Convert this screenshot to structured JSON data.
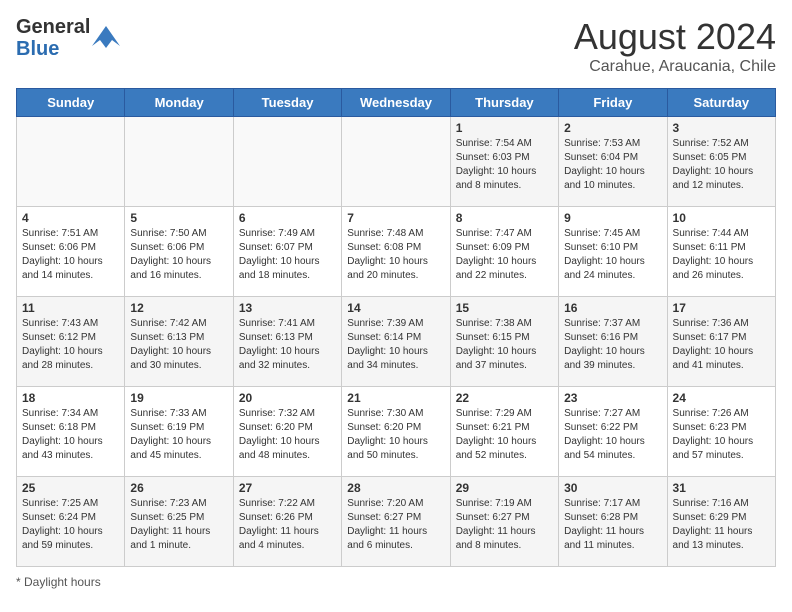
{
  "header": {
    "logo": {
      "text_general": "General",
      "text_blue": "Blue"
    },
    "title": "August 2024",
    "subtitle": "Carahue, Araucania, Chile"
  },
  "calendar": {
    "days_of_week": [
      "Sunday",
      "Monday",
      "Tuesday",
      "Wednesday",
      "Thursday",
      "Friday",
      "Saturday"
    ],
    "weeks": [
      [
        {
          "day": "",
          "info": ""
        },
        {
          "day": "",
          "info": ""
        },
        {
          "day": "",
          "info": ""
        },
        {
          "day": "",
          "info": ""
        },
        {
          "day": "1",
          "info": "Sunrise: 7:54 AM\nSunset: 6:03 PM\nDaylight: 10 hours\nand 8 minutes."
        },
        {
          "day": "2",
          "info": "Sunrise: 7:53 AM\nSunset: 6:04 PM\nDaylight: 10 hours\nand 10 minutes."
        },
        {
          "day": "3",
          "info": "Sunrise: 7:52 AM\nSunset: 6:05 PM\nDaylight: 10 hours\nand 12 minutes."
        }
      ],
      [
        {
          "day": "4",
          "info": "Sunrise: 7:51 AM\nSunset: 6:06 PM\nDaylight: 10 hours\nand 14 minutes."
        },
        {
          "day": "5",
          "info": "Sunrise: 7:50 AM\nSunset: 6:06 PM\nDaylight: 10 hours\nand 16 minutes."
        },
        {
          "day": "6",
          "info": "Sunrise: 7:49 AM\nSunset: 6:07 PM\nDaylight: 10 hours\nand 18 minutes."
        },
        {
          "day": "7",
          "info": "Sunrise: 7:48 AM\nSunset: 6:08 PM\nDaylight: 10 hours\nand 20 minutes."
        },
        {
          "day": "8",
          "info": "Sunrise: 7:47 AM\nSunset: 6:09 PM\nDaylight: 10 hours\nand 22 minutes."
        },
        {
          "day": "9",
          "info": "Sunrise: 7:45 AM\nSunset: 6:10 PM\nDaylight: 10 hours\nand 24 minutes."
        },
        {
          "day": "10",
          "info": "Sunrise: 7:44 AM\nSunset: 6:11 PM\nDaylight: 10 hours\nand 26 minutes."
        }
      ],
      [
        {
          "day": "11",
          "info": "Sunrise: 7:43 AM\nSunset: 6:12 PM\nDaylight: 10 hours\nand 28 minutes."
        },
        {
          "day": "12",
          "info": "Sunrise: 7:42 AM\nSunset: 6:13 PM\nDaylight: 10 hours\nand 30 minutes."
        },
        {
          "day": "13",
          "info": "Sunrise: 7:41 AM\nSunset: 6:13 PM\nDaylight: 10 hours\nand 32 minutes."
        },
        {
          "day": "14",
          "info": "Sunrise: 7:39 AM\nSunset: 6:14 PM\nDaylight: 10 hours\nand 34 minutes."
        },
        {
          "day": "15",
          "info": "Sunrise: 7:38 AM\nSunset: 6:15 PM\nDaylight: 10 hours\nand 37 minutes."
        },
        {
          "day": "16",
          "info": "Sunrise: 7:37 AM\nSunset: 6:16 PM\nDaylight: 10 hours\nand 39 minutes."
        },
        {
          "day": "17",
          "info": "Sunrise: 7:36 AM\nSunset: 6:17 PM\nDaylight: 10 hours\nand 41 minutes."
        }
      ],
      [
        {
          "day": "18",
          "info": "Sunrise: 7:34 AM\nSunset: 6:18 PM\nDaylight: 10 hours\nand 43 minutes."
        },
        {
          "day": "19",
          "info": "Sunrise: 7:33 AM\nSunset: 6:19 PM\nDaylight: 10 hours\nand 45 minutes."
        },
        {
          "day": "20",
          "info": "Sunrise: 7:32 AM\nSunset: 6:20 PM\nDaylight: 10 hours\nand 48 minutes."
        },
        {
          "day": "21",
          "info": "Sunrise: 7:30 AM\nSunset: 6:20 PM\nDaylight: 10 hours\nand 50 minutes."
        },
        {
          "day": "22",
          "info": "Sunrise: 7:29 AM\nSunset: 6:21 PM\nDaylight: 10 hours\nand 52 minutes."
        },
        {
          "day": "23",
          "info": "Sunrise: 7:27 AM\nSunset: 6:22 PM\nDaylight: 10 hours\nand 54 minutes."
        },
        {
          "day": "24",
          "info": "Sunrise: 7:26 AM\nSunset: 6:23 PM\nDaylight: 10 hours\nand 57 minutes."
        }
      ],
      [
        {
          "day": "25",
          "info": "Sunrise: 7:25 AM\nSunset: 6:24 PM\nDaylight: 10 hours\nand 59 minutes."
        },
        {
          "day": "26",
          "info": "Sunrise: 7:23 AM\nSunset: 6:25 PM\nDaylight: 11 hours\nand 1 minute."
        },
        {
          "day": "27",
          "info": "Sunrise: 7:22 AM\nSunset: 6:26 PM\nDaylight: 11 hours\nand 4 minutes."
        },
        {
          "day": "28",
          "info": "Sunrise: 7:20 AM\nSunset: 6:27 PM\nDaylight: 11 hours\nand 6 minutes."
        },
        {
          "day": "29",
          "info": "Sunrise: 7:19 AM\nSunset: 6:27 PM\nDaylight: 11 hours\nand 8 minutes."
        },
        {
          "day": "30",
          "info": "Sunrise: 7:17 AM\nSunset: 6:28 PM\nDaylight: 11 hours\nand 11 minutes."
        },
        {
          "day": "31",
          "info": "Sunrise: 7:16 AM\nSunset: 6:29 PM\nDaylight: 11 hours\nand 13 minutes."
        }
      ]
    ]
  },
  "footer": {
    "note": "Daylight hours"
  }
}
